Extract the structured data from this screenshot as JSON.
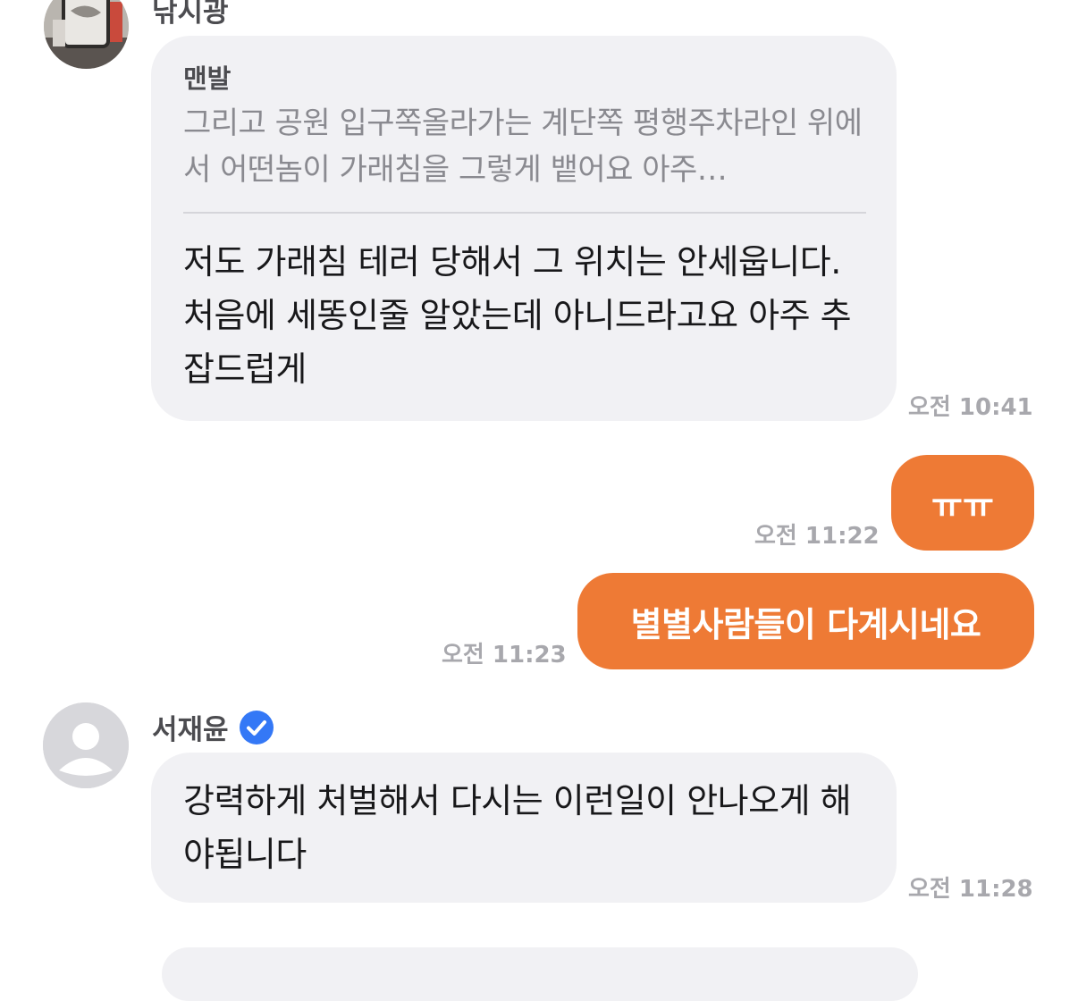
{
  "messages": {
    "first": {
      "sender": "낚시광",
      "quote_author": "맨발",
      "quote_text": "그리고 공원 입구쪽올라가는 계단쪽  평행주차라인 위에서 어떤놈이 가래침을 그렇게 뱉어요 아주…",
      "text": "저도 가래침 테러 당해서 그 위치는 안세웁니다. 처음에 세똥인줄 알았는데 아니드라고요 아주 추잡드럽게",
      "time": "오전 10:41"
    },
    "second": {
      "text": "ㅠㅠ",
      "time": "오전 11:22"
    },
    "third": {
      "text": "별별사람들이 다계시네요",
      "time": "오전 11:23"
    },
    "fourth": {
      "sender": "서재윤",
      "text": "강력하게 처벌해서 다시는 이런일이 안나오게 해야됩니다",
      "time": "오전 11:28"
    }
  },
  "colors": {
    "outgoing_bubble": "#ee7a35",
    "incoming_bubble": "#f1f1f4",
    "verified_badge": "#3478f6"
  },
  "icons": {
    "verified": "verified-check-icon",
    "default_avatar": "person-icon"
  }
}
